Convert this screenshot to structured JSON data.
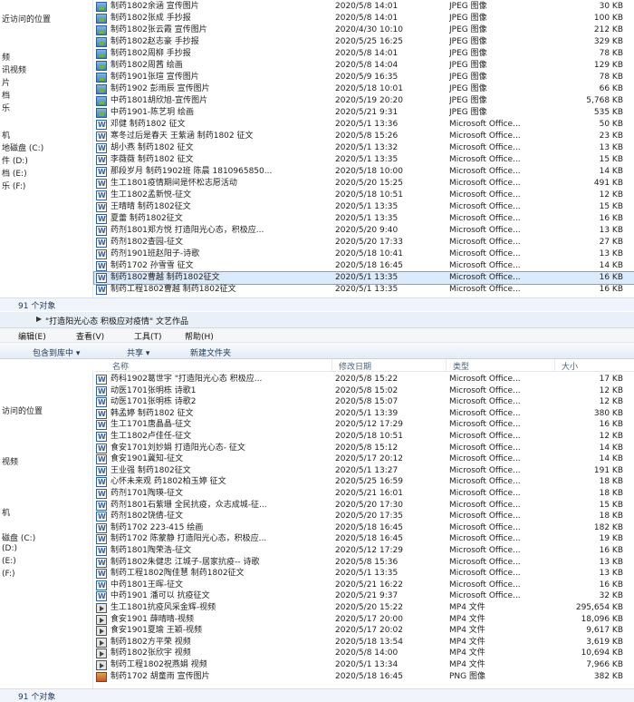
{
  "pane1": {
    "nav": [
      "近访问的位置",
      "频",
      "讯视频",
      "片",
      "档",
      "乐",
      "机",
      "地磁盘 (C:)",
      "件 (D:)",
      "档 (E:)",
      "乐 (F:)"
    ],
    "status": "91 个对象",
    "rows": [
      {
        "name": "制药1802余涵 宣传图片",
        "date": "2020/5/8 14:01",
        "type": "JPEG 图像",
        "size": "30 KB",
        "icon": "jpg"
      },
      {
        "name": "制药1802张成 手抄报",
        "date": "2020/5/8 14:01",
        "type": "JPEG 图像",
        "size": "100 KB",
        "icon": "jpg"
      },
      {
        "name": "制药1802张云霞 宣传图片",
        "date": "2020/4/30 10:10",
        "type": "JPEG 图像",
        "size": "212 KB",
        "icon": "jpg"
      },
      {
        "name": "制药1802赵志豪 手抄报",
        "date": "2020/5/25 16:25",
        "type": "JPEG 图像",
        "size": "329 KB",
        "icon": "jpg"
      },
      {
        "name": "制药1802周柳 手抄报",
        "date": "2020/5/8 14:01",
        "type": "JPEG 图像",
        "size": "78 KB",
        "icon": "jpg"
      },
      {
        "name": "制药1802周茜 绘画",
        "date": "2020/5/8 14:04",
        "type": "JPEG 图像",
        "size": "129 KB",
        "icon": "jpg"
      },
      {
        "name": "制药1901张瑄 宣传图片",
        "date": "2020/5/9 16:35",
        "type": "JPEG 图像",
        "size": "78 KB",
        "icon": "jpg"
      },
      {
        "name": "制药1902 彭雨辰 宣传图片",
        "date": "2020/5/18 10:01",
        "type": "JPEG 图像",
        "size": "66 KB",
        "icon": "jpg"
      },
      {
        "name": "中药1801胡欣旭-宣传图片",
        "date": "2020/5/19 20:20",
        "type": "JPEG 图像",
        "size": "5,768 KB",
        "icon": "jpg"
      },
      {
        "name": "中药1901-陈艺玥 绘画",
        "date": "2020/5/21 9:31",
        "type": "JPEG 图像",
        "size": "535 KB",
        "icon": "jpg"
      },
      {
        "name": "邓健 制药1802 征文",
        "date": "2020/5/1 13:36",
        "type": "Microsoft Office...",
        "size": "50 KB",
        "icon": "doc"
      },
      {
        "name": "寒冬过后是春天 王紫涵 制药1802 征文",
        "date": "2020/5/8 15:26",
        "type": "Microsoft Office...",
        "size": "23 KB",
        "icon": "doc"
      },
      {
        "name": "胡小燕 制药1802 征文",
        "date": "2020/5/1 13:32",
        "type": "Microsoft Office...",
        "size": "13 KB",
        "icon": "doc"
      },
      {
        "name": "李薇薇 制药1802 征文",
        "date": "2020/5/1 13:35",
        "type": "Microsoft Office...",
        "size": "15 KB",
        "icon": "doc"
      },
      {
        "name": "那段岁月 制药1902班 陈晨 1810965850...",
        "date": "2020/5/18 10:00",
        "type": "Microsoft Office...",
        "size": "14 KB",
        "icon": "doc"
      },
      {
        "name": "生工1801疫情期间是怀松志愿活动",
        "date": "2020/5/20 15:25",
        "type": "Microsoft Office...",
        "size": "491 KB",
        "icon": "doc"
      },
      {
        "name": "生工1802孟新悦-征文",
        "date": "2020/5/18 10:51",
        "type": "Microsoft Office...",
        "size": "12 KB",
        "icon": "doc"
      },
      {
        "name": "王晴晴 制药1802征文",
        "date": "2020/5/1 13:35",
        "type": "Microsoft Office...",
        "size": "15 KB",
        "icon": "doc"
      },
      {
        "name": "夏蕾 制药1802征文",
        "date": "2020/5/1 13:35",
        "type": "Microsoft Office...",
        "size": "16 KB",
        "icon": "doc"
      },
      {
        "name": "药剂1801郑方悦 打造阳光心态，积极应...",
        "date": "2020/5/20 9:40",
        "type": "Microsoft Office...",
        "size": "13 KB",
        "icon": "doc"
      },
      {
        "name": "药剂1802查园-征文",
        "date": "2020/5/20 17:33",
        "type": "Microsoft Office...",
        "size": "27 KB",
        "icon": "doc"
      },
      {
        "name": "药剂1901班赵阳子-诗歌",
        "date": "2020/5/18 10:41",
        "type": "Microsoft Office...",
        "size": "13 KB",
        "icon": "doc"
      },
      {
        "name": "制药1702 孙雪雪 征文",
        "date": "2020/5/18 16:45",
        "type": "Microsoft Office...",
        "size": "14 KB",
        "icon": "doc"
      },
      {
        "name": "制药1802曹越 制药1802征文",
        "date": "2020/5/1 13:35",
        "type": "Microsoft Office...",
        "size": "16 KB",
        "icon": "doc",
        "selected": true
      },
      {
        "name": "制药工程1802曹越 制药1802征文",
        "date": "2020/5/1 13:35",
        "type": "Microsoft Office...",
        "size": "16 KB",
        "icon": "doc"
      }
    ]
  },
  "pane2": {
    "address": "\"打造阳光心态 积极应对疫情\" 文艺作品",
    "menus": [
      "编辑(E)",
      "查看(V)",
      "工具(T)",
      "帮助(H)"
    ],
    "toolbar": [
      "包含到库中 ▾",
      "共享 ▾",
      "新建文件夹"
    ],
    "headers": {
      "name": "名称",
      "date": "修改日期",
      "type": "类型",
      "size": "大小"
    },
    "nav": [
      "访问的位置",
      "视频",
      "机",
      "磁盘 (C:)",
      "(D:)",
      "(E:)",
      "(F:)"
    ],
    "status": "91 个对象",
    "rows": [
      {
        "name": "药科1902葛世宇 \"打造阳光心态 积极应...",
        "date": "2020/5/8 15:22",
        "type": "Microsoft Office...",
        "size": "17 KB",
        "icon": "doc"
      },
      {
        "name": "动医1701张明栋 诗歌1",
        "date": "2020/5/8 15:02",
        "type": "Microsoft Office...",
        "size": "12 KB",
        "icon": "doc"
      },
      {
        "name": "动医1701张明栋 诗歌2",
        "date": "2020/5/8 15:07",
        "type": "Microsoft Office...",
        "size": "12 KB",
        "icon": "doc"
      },
      {
        "name": "韩孟婷 制药1802 征文",
        "date": "2020/5/1 13:39",
        "type": "Microsoft Office...",
        "size": "380 KB",
        "icon": "doc"
      },
      {
        "name": "生工1701唐晶晶-征文",
        "date": "2020/5/12 17:29",
        "type": "Microsoft Office...",
        "size": "16 KB",
        "icon": "doc"
      },
      {
        "name": "生工1802卢佳任-征文",
        "date": "2020/5/18 10:51",
        "type": "Microsoft Office...",
        "size": "12 KB",
        "icon": "doc"
      },
      {
        "name": "食安1701刘妙娟 打造阳光心态- 征文",
        "date": "2020/5/8 15:12",
        "type": "Microsoft Office...",
        "size": "14 KB",
        "icon": "doc"
      },
      {
        "name": "食安1901冀知-征文",
        "date": "2020/5/17 20:12",
        "type": "Microsoft Office...",
        "size": "14 KB",
        "icon": "doc"
      },
      {
        "name": "王业强 制药1802征文",
        "date": "2020/5/1 13:27",
        "type": "Microsoft Office...",
        "size": "191 KB",
        "icon": "doc"
      },
      {
        "name": "心怀未来观 药1802柏玉婷 征文",
        "date": "2020/5/25 16:59",
        "type": "Microsoft Office...",
        "size": "18 KB",
        "icon": "doc"
      },
      {
        "name": "药剂1701陶瑛-征文",
        "date": "2020/5/21 16:01",
        "type": "Microsoft Office...",
        "size": "18 KB",
        "icon": "doc"
      },
      {
        "name": "药剂1801石紫珊 全民抗疫，众志成城-征...",
        "date": "2020/5/20 17:30",
        "type": "Microsoft Office...",
        "size": "15 KB",
        "icon": "doc"
      },
      {
        "name": "药剂1802饶倩-征文",
        "date": "2020/5/20 17:35",
        "type": "Microsoft Office...",
        "size": "18 KB",
        "icon": "doc"
      },
      {
        "name": "制药1702 223-415 绘画",
        "date": "2020/5/18 16:45",
        "type": "Microsoft Office...",
        "size": "182 KB",
        "icon": "doc"
      },
      {
        "name": "制药1702 陈蒙静 打造阳光心态，积极应...",
        "date": "2020/5/18 16:45",
        "type": "Microsoft Office...",
        "size": "19 KB",
        "icon": "doc"
      },
      {
        "name": "制药1801陶荣浩-征文",
        "date": "2020/5/12 17:29",
        "type": "Microsoft Office...",
        "size": "16 KB",
        "icon": "doc"
      },
      {
        "name": "制药1802朱健忠 江城子-居家抗疫-- 诗歌",
        "date": "2020/5/8 15:36",
        "type": "Microsoft Office...",
        "size": "13 KB",
        "icon": "doc"
      },
      {
        "name": "制药工程1802陶佳慧 制药1802征文",
        "date": "2020/5/1 13:35",
        "type": "Microsoft Office...",
        "size": "13 KB",
        "icon": "doc"
      },
      {
        "name": "中药1801王晖-征文",
        "date": "2020/5/21 16:22",
        "type": "Microsoft Office...",
        "size": "16 KB",
        "icon": "doc"
      },
      {
        "name": "中药1901 潘可以 抗疫征文",
        "date": "2020/5/21 9:37",
        "type": "Microsoft Office...",
        "size": "32 KB",
        "icon": "doc"
      },
      {
        "name": "生工1801抗疫风采金辉-视频",
        "date": "2020/5/20 15:22",
        "type": "MP4 文件",
        "size": "295,654 KB",
        "icon": "mp4"
      },
      {
        "name": "食安1901 薛晴晴-视频",
        "date": "2020/5/17 20:00",
        "type": "MP4 文件",
        "size": "18,096 KB",
        "icon": "mp4"
      },
      {
        "name": "食安1901夏瑜 王颖-视频",
        "date": "2020/5/17 20:02",
        "type": "MP4 文件",
        "size": "9,617 KB",
        "icon": "mp4"
      },
      {
        "name": "制药1802方平荣 视频",
        "date": "2020/5/18 13:54",
        "type": "MP4 文件",
        "size": "3,619 KB",
        "icon": "mp4"
      },
      {
        "name": "制药1802张欣宇 视频",
        "date": "2020/5/8 14:00",
        "type": "MP4 文件",
        "size": "10,694 KB",
        "icon": "mp4"
      },
      {
        "name": "制药工程1802祝燕娟 视频",
        "date": "2020/5/1 13:34",
        "type": "MP4 文件",
        "size": "7,966 KB",
        "icon": "mp4"
      },
      {
        "name": "制药1702 胡童雨 宣传图片",
        "date": "2020/5/18 16:45",
        "type": "PNG 图像",
        "size": "382 KB",
        "icon": "png"
      }
    ]
  }
}
